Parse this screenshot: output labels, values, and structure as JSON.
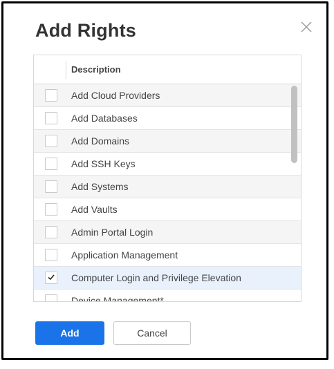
{
  "dialog": {
    "title": "Add Rights",
    "close_icon": "close-icon"
  },
  "table": {
    "column_header": "Description",
    "rows": [
      {
        "label": "Add Cloud Providers",
        "checked": false
      },
      {
        "label": "Add Databases",
        "checked": false
      },
      {
        "label": "Add Domains",
        "checked": false
      },
      {
        "label": "Add SSH Keys",
        "checked": false
      },
      {
        "label": "Add Systems",
        "checked": false
      },
      {
        "label": "Add Vaults",
        "checked": false
      },
      {
        "label": "Admin Portal Login",
        "checked": false
      },
      {
        "label": "Application Management",
        "checked": false
      },
      {
        "label": "Computer Login and Privilege Elevation",
        "checked": true
      },
      {
        "label": "Device Management*",
        "checked": false
      }
    ]
  },
  "buttons": {
    "add_label": "Add",
    "cancel_label": "Cancel"
  },
  "colors": {
    "primary": "#1a73e8",
    "selected_row": "#e8f1fc"
  }
}
